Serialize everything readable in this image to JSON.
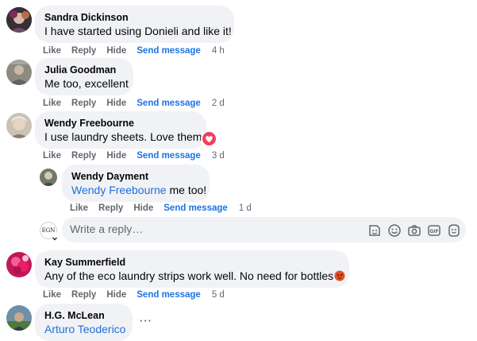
{
  "comments": [
    {
      "author": "Sandra Dickinson",
      "text": "I have started using Donieli and like it!",
      "like": "Like",
      "reply": "Reply",
      "hide": "Hide",
      "send": "Send message",
      "time": "4 h"
    },
    {
      "author": "Julia Goodman",
      "text": "Me too, excellent",
      "like": "Like",
      "reply": "Reply",
      "hide": "Hide",
      "send": "Send message",
      "time": "2 d"
    },
    {
      "author": "Wendy Freebourne",
      "text": "I use laundry sheets. Love them.",
      "like": "Like",
      "reply": "Reply",
      "hide": "Hide",
      "send": "Send message",
      "time": "3 d",
      "reaction": "heart-reaction-icon"
    },
    {
      "author": "Wendy Dayment",
      "mention": "Wendy Freebourne",
      "text": " me too!",
      "like": "Like",
      "reply": "Reply",
      "hide": "Hide",
      "send": "Send message",
      "time": "1 d"
    },
    {
      "author": "Kay Summerfield",
      "text": "Any of the eco laundry strips work well. No need for bottles",
      "like": "Like",
      "reply": "Reply",
      "hide": "Hide",
      "send": "Send message",
      "time": "5 d",
      "emoji": "angry-face-emoji"
    },
    {
      "author": "H.G. McLean",
      "mention": "Arturo Teoderico",
      "more": "···"
    }
  ],
  "reply_box": {
    "avatar_text": "EGN",
    "placeholder": "Write a reply…",
    "icons": [
      "sticker-icon",
      "emoji-icon",
      "camera-icon",
      "gif-icon",
      "avatar-sticker-icon"
    ]
  },
  "colors": {
    "link": "#1b74e4",
    "mention": "#216fdb",
    "bubble": "#f0f2f5",
    "meta": "#65676b",
    "heart": "#f33e58"
  }
}
